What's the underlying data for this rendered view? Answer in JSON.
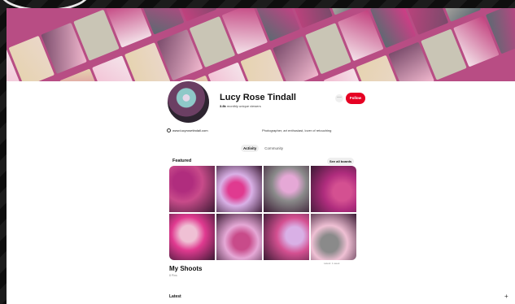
{
  "profile": {
    "name": "Lucy Rose Tindall",
    "viewers_count": "3.8k",
    "viewers_label": "monthly unique viewers",
    "website": "www.lucyrosetindall.com",
    "bio": "Photographer, art enthusiast, lover of retouching"
  },
  "header_actions": {
    "more_label": "···",
    "follow_label": "Follow"
  },
  "tabs": [
    {
      "label": "Activity",
      "active": true
    },
    {
      "label": "Community",
      "active": false
    }
  ],
  "featured": {
    "title": "Featured",
    "see_all_label": "See all boards"
  },
  "board": {
    "title": "My Shoots",
    "subtitle": "8 Pins",
    "date": "Latest: 1 week"
  },
  "latest_label": "Latest",
  "plus_label": "+",
  "colors": {
    "follow": "#e60023",
    "cover_palette": [
      "#d43b87",
      "#f2b9cf",
      "#e6d3b0",
      "#7a4b6b",
      "#c9c5b5",
      "#f4e3ea",
      "#5d6a72",
      "#c2417e",
      "#ead7c8",
      "#8f9d9a"
    ],
    "board_cells": [
      "#c84b8a",
      "#d9b0e6",
      "#8a8a8a",
      "#b02d7e",
      "#e03a90",
      "#e5a8d6",
      "#d45091",
      "#efc0d4"
    ]
  }
}
